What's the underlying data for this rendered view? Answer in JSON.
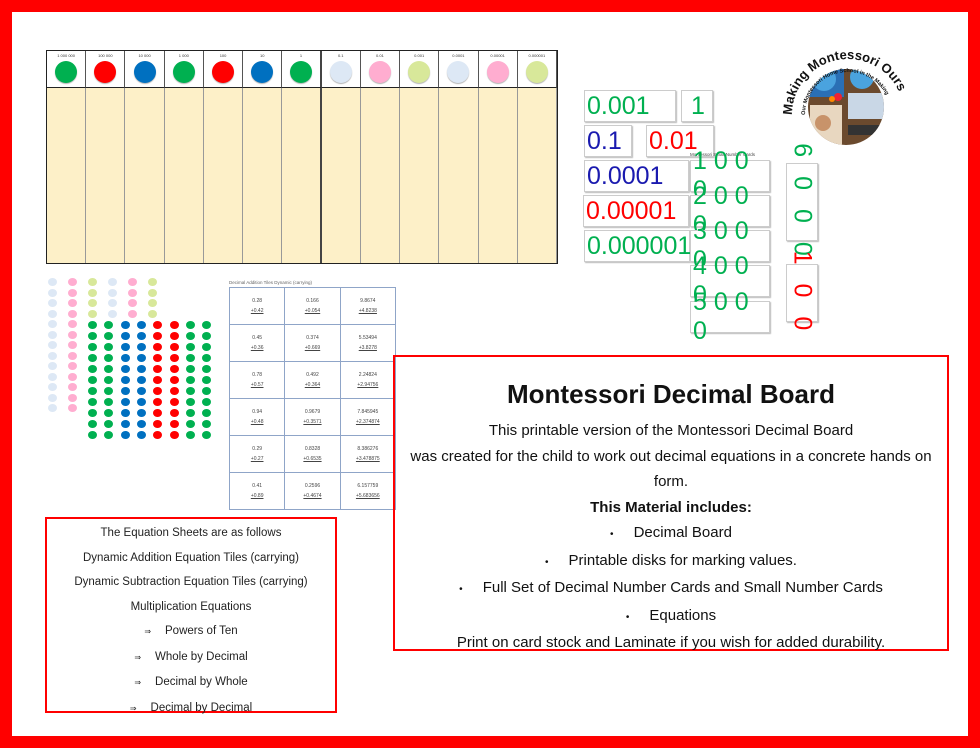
{
  "board": {
    "columns": [
      {
        "label": "1 000 000",
        "color": "#00b050"
      },
      {
        "label": "100 000",
        "color": "#ff0000"
      },
      {
        "label": "10 000",
        "color": "#0070c0"
      },
      {
        "label": "1 000",
        "color": "#00b050"
      },
      {
        "label": "100",
        "color": "#ff0000"
      },
      {
        "label": "10",
        "color": "#0070c0"
      },
      {
        "label": "1",
        "color": "#00b050"
      },
      {
        "label": "0.1",
        "color": "#dde8f5"
      },
      {
        "label": "0.01",
        "color": "#ffadd0"
      },
      {
        "label": "0.001",
        "color": "#d8e89a"
      },
      {
        "label": "0.0001",
        "color": "#dde8f5"
      },
      {
        "label": "0.00001",
        "color": "#ffadd0"
      },
      {
        "label": "0.000001",
        "color": "#d8e89a"
      }
    ]
  },
  "equation_tiles": {
    "title": "Decimal Addition Tiles  Dynamic (carrying)",
    "rows": [
      [
        [
          "0.28",
          "+0.42"
        ],
        [
          "0.166",
          "+0.054"
        ],
        [
          "9.8674",
          "+4.8238"
        ]
      ],
      [
        [
          "0.45",
          "+0.36"
        ],
        [
          "0.374",
          "+0.669"
        ],
        [
          "5.53494",
          "+3.8278"
        ]
      ],
      [
        [
          "0.78",
          "+0.57"
        ],
        [
          "0.492",
          "+0.364"
        ],
        [
          "2.24824",
          "+2.94756"
        ]
      ],
      [
        [
          "0.94",
          "+0.48"
        ],
        [
          "0.9679",
          "+0.3571"
        ],
        [
          "7.845945",
          "+2.374874"
        ]
      ],
      [
        [
          "0.29",
          "+0.27"
        ],
        [
          "0.8328",
          "+0.6535"
        ],
        [
          "8.386276",
          "+3.478875"
        ]
      ],
      [
        [
          "0.41",
          "+0.89"
        ],
        [
          "0.2596",
          "+0.4674"
        ],
        [
          "6.157759",
          "+5.683656"
        ]
      ]
    ]
  },
  "decimal_cards": [
    "0.001",
    "1",
    "0.1",
    "0.01",
    "0.0001",
    "0.00001",
    "0.000001"
  ],
  "small_number_cards": {
    "title": "Montessori Small Number Cards",
    "cards": [
      "1 0 0 0",
      "2 0 0 0",
      "3 0 0 0",
      "4 0 0 0",
      "5 0 0 0"
    ],
    "vertical": [
      "6 0 0 0",
      "1 0 0"
    ]
  },
  "logo": {
    "text": "Making Montessori Ours",
    "subtext": "Our Montessori Home School in the Making"
  },
  "description": {
    "title": "Montessori Decimal Board",
    "lines": [
      "This printable version of the Montessori Decimal Board",
      "was created for  the child to work out decimal equations in a concrete hands on form."
    ],
    "includes_heading": "This Material includes:",
    "items": [
      "Decimal Board",
      "Printable disks for marking values.",
      "Full Set of Decimal Number Cards and Small Number Cards",
      "Equations"
    ],
    "footer": "Print on card stock and Laminate if you wish for added durability."
  },
  "equation_sheets": {
    "lines": [
      "The Equation Sheets  are as follows",
      "Dynamic  Addition Equation Tiles (carrying)",
      "Dynamic  Subtraction Equation Tiles (carrying)",
      "Multiplication Equations"
    ],
    "sub": [
      "Powers of Ten",
      "Whole by Decimal",
      "Decimal by Whole",
      "Decimal by Decimal"
    ]
  }
}
